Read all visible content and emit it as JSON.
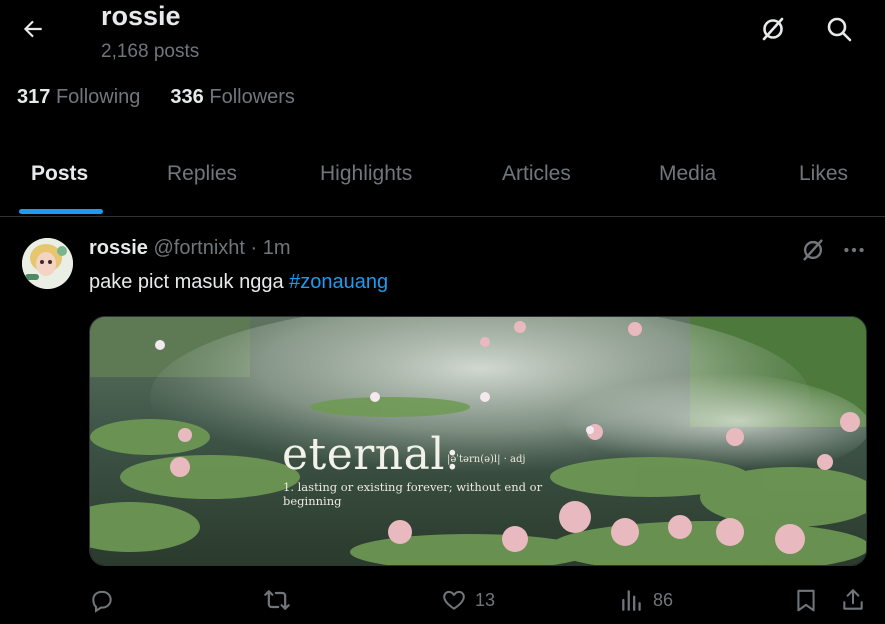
{
  "header": {
    "name": "rossie",
    "posts_count": "2,168 posts",
    "back_icon": "arrow-left-icon",
    "grok_icon": "grok-icon",
    "search_icon": "search-icon"
  },
  "stats": {
    "following_count": "317",
    "following_label": "Following",
    "followers_count": "336",
    "followers_label": "Followers"
  },
  "tabs": [
    {
      "label": "Posts",
      "active": true
    },
    {
      "label": "Replies"
    },
    {
      "label": "Highlights"
    },
    {
      "label": "Articles"
    },
    {
      "label": "Media"
    },
    {
      "label": "Likes"
    }
  ],
  "tweet": {
    "author_name": "rossie",
    "handle": "@fortnixht",
    "separator": "·",
    "time": "1m",
    "text": "pake pict masuk ngga ",
    "hashtag": "#zonauang",
    "media": {
      "word": "eternal:",
      "phonetic": "|əˈtərn(ə)l| · adj",
      "definition": "1. lasting or existing forever; without end or beginning"
    },
    "actions": {
      "reply_count": "",
      "repost_count": "",
      "like_count": "13",
      "views_count": "86"
    }
  },
  "colors": {
    "background": "#000000",
    "text_primary": "#e7e9ea",
    "text_secondary": "#71767b",
    "accent": "#1d9bf0",
    "divider": "#2f3336"
  }
}
